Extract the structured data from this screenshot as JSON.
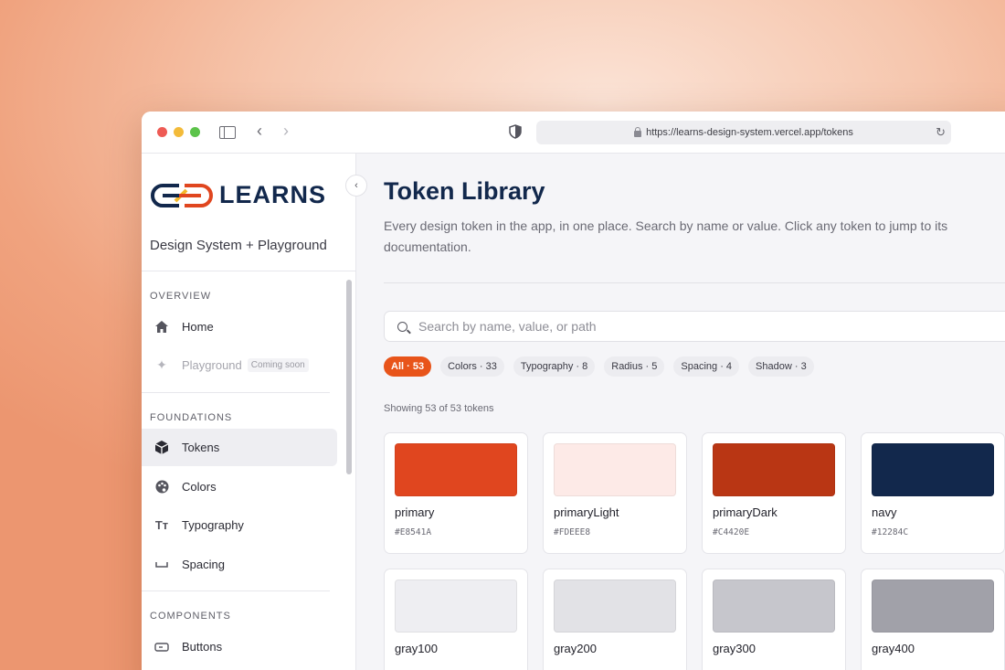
{
  "browser": {
    "url": "https://learns-design-system.vercel.app/tokens"
  },
  "sidebar": {
    "logo_text": "LEARNS",
    "subtitle": "Design System + Playground",
    "sections": {
      "overview": "OVERVIEW",
      "foundations": "FOUNDATIONS",
      "components": "COMPONENTS"
    },
    "items": [
      {
        "label": "Home",
        "icon": "home-icon"
      },
      {
        "label": "Playground",
        "icon": "sparkle-icon",
        "badge": "Coming soon"
      },
      {
        "label": "Tokens",
        "icon": "cube-icon"
      },
      {
        "label": "Colors",
        "icon": "palette-icon"
      },
      {
        "label": "Typography",
        "icon": "type-icon"
      },
      {
        "label": "Spacing",
        "icon": "spacing-icon"
      },
      {
        "label": "Buttons",
        "icon": "button-icon"
      }
    ]
  },
  "main": {
    "title": "Token Library",
    "description": "Every design token in the app, in one place. Search by name or value. Click any token to jump to its documentation.",
    "search_placeholder": "Search by name, value, or path",
    "filters": [
      "All · 53",
      "Colors · 33",
      "Typography · 8",
      "Radius · 5",
      "Spacing · 4",
      "Shadow · 3"
    ],
    "showing": "Showing 53 of 53 tokens",
    "tokens": [
      {
        "name": "primary",
        "value": "#E8541A",
        "color": "#E0461F"
      },
      {
        "name": "primaryLight",
        "value": "#FDEEE8",
        "color": "#FDEAE7"
      },
      {
        "name": "primaryDark",
        "value": "#C4420E",
        "color": "#B93614"
      },
      {
        "name": "navy",
        "value": "#12284C",
        "color": "#12284C"
      },
      {
        "name": "gray100",
        "value": "",
        "color": "#EEEEF2"
      },
      {
        "name": "gray200",
        "value": "",
        "color": "#E2E2E6"
      },
      {
        "name": "gray300",
        "value": "",
        "color": "#C6C6CC"
      },
      {
        "name": "gray400",
        "value": "",
        "color": "#A1A1A9"
      }
    ]
  },
  "colors": {
    "accent": "#E8541A",
    "navy": "#12284C",
    "logo_yellow": "#F4B82A"
  }
}
